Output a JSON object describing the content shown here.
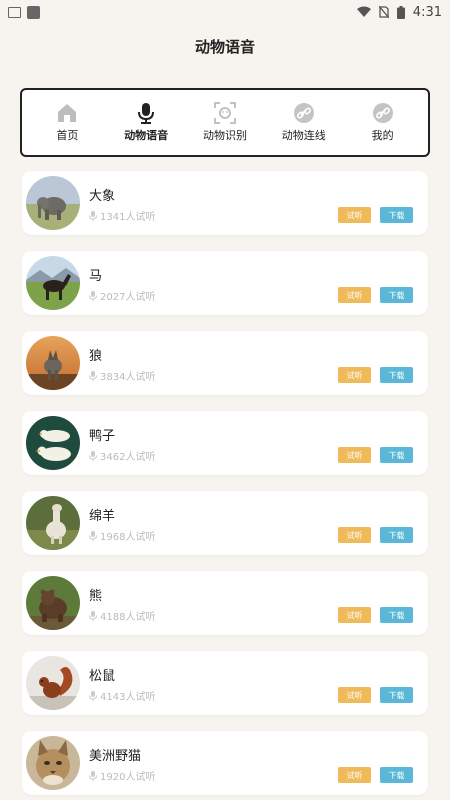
{
  "status": {
    "time": "4:31"
  },
  "header": {
    "title": "动物语音"
  },
  "tabs": [
    {
      "label": "首页",
      "icon": "home-icon"
    },
    {
      "label": "动物语音",
      "icon": "microphone-icon"
    },
    {
      "label": "动物识别",
      "icon": "scan-face-icon"
    },
    {
      "label": "动物连线",
      "icon": "link-icon"
    },
    {
      "label": "我的",
      "icon": "link-icon"
    }
  ],
  "buttons": {
    "listen": "试听",
    "download": "下载"
  },
  "animals": [
    {
      "name": "大象",
      "plays": "1341人试听",
      "image": "elephant-photo"
    },
    {
      "name": "马",
      "plays": "2027人试听",
      "image": "horse-photo"
    },
    {
      "name": "狼",
      "plays": "3834人试听",
      "image": "wolf-photo"
    },
    {
      "name": "鸭子",
      "plays": "3462人试听",
      "image": "duck-photo"
    },
    {
      "name": "绵羊",
      "plays": "1968人试听",
      "image": "sheep-photo"
    },
    {
      "name": "熊",
      "plays": "4188人试听",
      "image": "bear-photo"
    },
    {
      "name": "松鼠",
      "plays": "4143人试听",
      "image": "squirrel-photo"
    },
    {
      "name": "美洲野猫",
      "plays": "1920人试听",
      "image": "bobcat-photo"
    }
  ],
  "colors": {
    "background": "#f7f3ee",
    "listen": "#f0b95a",
    "download": "#5ab7d8"
  }
}
